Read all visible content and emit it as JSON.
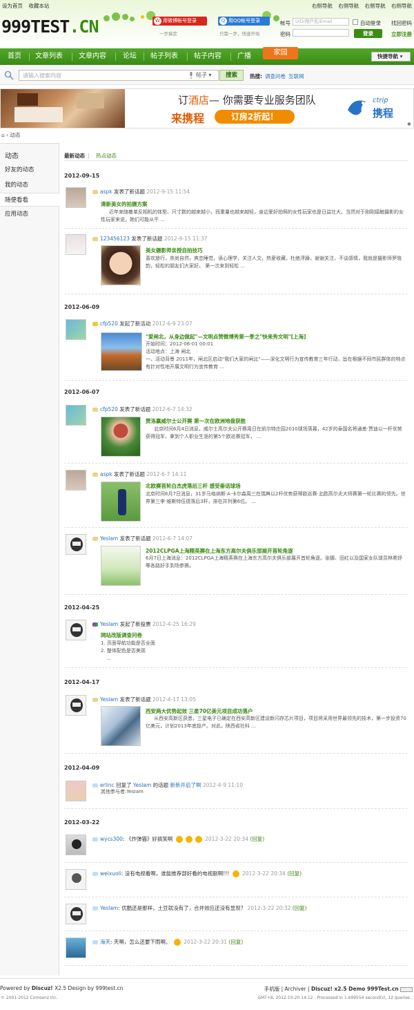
{
  "topbar": {
    "left": [
      "设为首页",
      "收藏本站"
    ],
    "right": [
      "右侧导航",
      "右侧导航",
      "右侧导航",
      "右侧导航"
    ]
  },
  "logo": {
    "main": "999TEST",
    "suffix": ".CN"
  },
  "login": {
    "weibo_label": "用微博帐号登录",
    "weibo_sub": "一步搞定",
    "qq_label": "用QQ帐号登录",
    "qq_sub": "只需一步，快速开始",
    "account_label": "帐号",
    "account_placeholder": "UID/用户名/Email",
    "password_label": "密码",
    "auto_login": "自动登录",
    "forgot": "找回密码",
    "login_button": "登录",
    "register": "立即注册"
  },
  "nav": {
    "items": [
      "首页",
      "文章列表",
      "文章内容",
      "论坛",
      "帖子列表",
      "帖子内容",
      "广播"
    ],
    "home": "家园",
    "quick": "快捷导航"
  },
  "search": {
    "placeholder": "请输入搜索内容",
    "type": "帖子",
    "button": "搜索",
    "hot_label": "热搜:",
    "hot": [
      "调查问卷",
      "互联网"
    ]
  },
  "banner": {
    "line1_prefix": "订",
    "line1_hotel": "酒店",
    "line1_rest": "— 你需要专业服务团队",
    "line2": "来携程",
    "pill": "订房2折起！",
    "brand_en": "ctrip",
    "brand_cn": "携程"
  },
  "breadcrumb": "动态",
  "sidebar": {
    "title": "动态",
    "items": [
      "好友的动态",
      "我的动态",
      "随便看看",
      "应用动态"
    ]
  },
  "tabs": {
    "active": "最新动态",
    "other": "热点动态"
  },
  "groups": [
    {
      "date": "2012-09-15"
    },
    {
      "date": "2012-06-09"
    },
    {
      "date": "2012-06-07"
    },
    {
      "date": "2012-04-25"
    },
    {
      "date": "2012-04-17"
    },
    {
      "date": "2012-04-09"
    },
    {
      "date": "2012-03-22"
    }
  ],
  "feeds": [
    {
      "user": "aspk",
      "action": "发表了新话题",
      "time": "2012-9-15 11:54",
      "title": "清新美女的拍摄方案",
      "text": "近年来随着单反相机的体型、尺寸数的越来越小，而重量也越来越轻，身边爱好拍照的女性玩家也是日益壮大。当然对于刚刚接触摄影的女性玩家来说，她们可能从不 ..."
    },
    {
      "user": "123456123",
      "action": "发表了新话题",
      "time": "2012-9-15 11:37",
      "title": "美女摄影师亲授自拍技巧",
      "text": "喜欢旅行，崇尚自然，爽恋睡觉，读心理学，关注人文，热爱收藏，杜绝浮躁，谢谢关注，不谈感情，我就是摄影师罗晓韵，轻松的朋友们大家好。 第一次来到轻松 ..."
    },
    {
      "user": "cfp520",
      "action": "发起了新活动",
      "time": "2012-6-9 23:07",
      "title": "\"爱闸北，从身边做起\"—文明点赞微博秀第一季之\"快来秀文明\"[上海]",
      "start": "开始时间：2012-06-01 00:01",
      "place": "活动地点：上海 闸北",
      "text": "一、活动背景 2011年，闸北区启动\"我们大家的闸北\"——深化文明行为宣传教育三年行动，旨在根据不同市民群体的特点有针对性地开展文明行为宣传教育 ..."
    },
    {
      "user": "cfp520",
      "action": "发表了新话题",
      "time": "2012-6-7 14:32",
      "title": "贾洛赢威尔士公开赛 第一次在欧洲地盘获胜",
      "text": "北京时间6月4日消息，威尔士高尔夫公开赛周日在凯尔特庄园2010球场落幕，42岁的泰国名将通差·贾迪以一杆优势获得冠军，拿到个人职业生涯的第5个欧巡赛冠军， ..."
    },
    {
      "user": "aspk",
      "action": "发表了新话题",
      "time": "2012-6-7 14:11",
      "title": "北欧赛首轮白杰虎落后三杆 感受垂话球场",
      "text": "北京时间6月7日消息，31岁马格纳斯·A·卡尔森周三在瑞典以2杆优势获得欧巡赛·北欧高尔夫大师赛第一轮比赛的领先。世界第三李·维斯特伍德落后3杆，排在并列第6位。 ..."
    },
    {
      "user": "YesIam",
      "action": "发表了新话题",
      "time": "2012-6-7 14:07",
      "title": "2012CLPGA上海精英赛在上海东方高尔夫俱乐部展开首轮角逐",
      "text": "6月7日上海消息：2012CLPGA上海精英赛在上海东方高尔夫俱乐部展开首轮角逐。张娜、田红以及国家女队球员林希妤等各路好手到场参赛。"
    },
    {
      "user": "YesIam",
      "action": "发起了新投票",
      "time": "2012-4-25 16:29",
      "title": "网站改版调查问卷",
      "options": [
        "1. 页面导航功能是否全面",
        "2. 整体配色是否美观",
        "..."
      ]
    },
    {
      "user": "YesIam",
      "action": "发表了新话题",
      "time": "2012-4-17 13:05",
      "title": "西安两大优势起效 三星70亿美元项目成功落户",
      "text": "从西安高新区获悉，三星电子已确定在西安高新区建设新闪存芯片项目，项目将采用世界最领先的技术，第一步投资70亿美元，计划2013年底投产。对此，陕西省社科 ..."
    },
    {
      "user": "erlinc",
      "action": "回复了",
      "target_user": "YesIam",
      "mid": "的话题",
      "target": "新新开启了啊",
      "time": "2012-4-9 11:10",
      "extra": "其他参与者:YesIam"
    },
    {
      "user": "wycs300",
      "text": "《炸弹猫》好搞笑啊",
      "time": "2012-3-22 20:34",
      "reply": "(回复)"
    },
    {
      "user": "weixuoli",
      "text": "没有电视看啊，谁能推荐部好看的电视剧啊!!!",
      "time": "2012-3-22 20:34",
      "reply": "(回复)"
    },
    {
      "user": "YesIam",
      "text": "优酷还是那样，土豆就没有了，合并效应还没有显现？",
      "time": "2012-3-22 20:32",
      "reply": "(回复)"
    },
    {
      "user": "海天",
      "text": "天啊，怎么还要下雨啊。",
      "time": "2012-3-22 20:31",
      "reply": "(回复)"
    }
  ],
  "footer": {
    "powered": "Powered by",
    "brand": "Discuz!",
    "version": "X2.5 Design by 999test.cn",
    "copyright": "© 2001-2012 Comsenz Inc.",
    "links": [
      "手机版",
      "Archiver"
    ],
    "demo": "Discuz! x2.5 Demo 999Test.cn",
    "stats": "GMT+8, 2012-10-20 14:12 , Processed in 1.699554 second(s), 12 queries ."
  },
  "colors": {
    "green": "#3a8a11",
    "orange": "#f07419",
    "link": "#2b6fb6"
  }
}
